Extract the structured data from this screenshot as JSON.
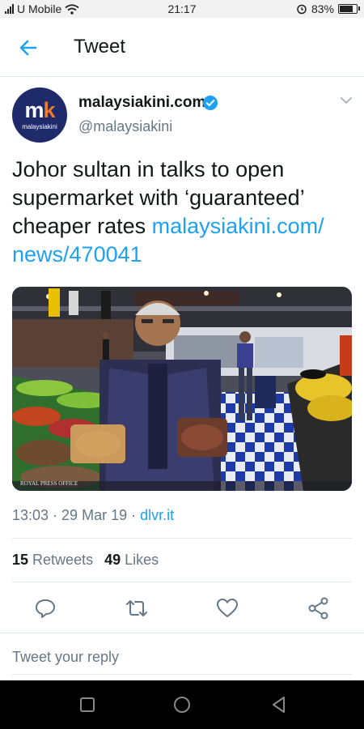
{
  "status_bar": {
    "carrier": "U Mobile",
    "time": "21:17",
    "battery": "83%",
    "battery_level": 0.83
  },
  "header": {
    "title": "Tweet"
  },
  "author": {
    "name": "malaysiakini.com",
    "handle": "@malaysiakini",
    "avatar_text": "malaysiakini"
  },
  "tweet": {
    "text": "Johor sultan in talks to open supermarket with ‘guaranteed’ cheaper rates ",
    "link": "malaysiakini.com/ news/470041"
  },
  "photo": {
    "watermark": "ROYAL PRESS OFFICE"
  },
  "meta": {
    "time": "13:03",
    "separator1": " · ",
    "date": "29 Mar 19",
    "separator2": " · ",
    "source": "dlvr.it"
  },
  "stats": {
    "retweets_count": "15",
    "retweets_label": "Retweets",
    "likes_count": "49",
    "likes_label": "Likes"
  },
  "actions": [
    "reply",
    "retweet",
    "like",
    "share"
  ],
  "reply": {
    "placeholder": "Tweet your reply"
  },
  "colors": {
    "link": "#1da1f2",
    "secondary_text": "#657786",
    "avatar_bg": "#1f2a6b",
    "nav_bar": "#000000"
  }
}
